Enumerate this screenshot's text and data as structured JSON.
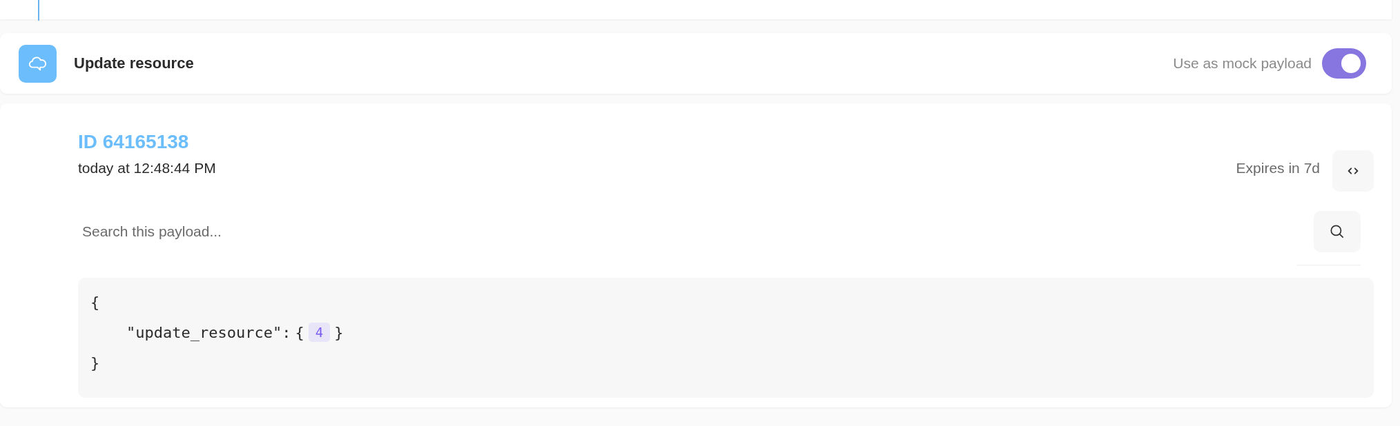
{
  "header": {
    "title": "Update resource",
    "toggle": {
      "label": "Use as mock payload",
      "on": true
    }
  },
  "payload": {
    "id": "ID 64165138",
    "timestamp": "today at 12:48:44 PM",
    "expires": "Expires in 7d",
    "search": {
      "placeholder": "Search this payload..."
    },
    "code": [
      {
        "kind": "text",
        "text": "{"
      },
      {
        "kind": "collapsed",
        "key": "\"update_resource\":",
        "open": "{",
        "count": "4",
        "close": "}"
      },
      {
        "kind": "text",
        "text": "}"
      }
    ]
  }
}
